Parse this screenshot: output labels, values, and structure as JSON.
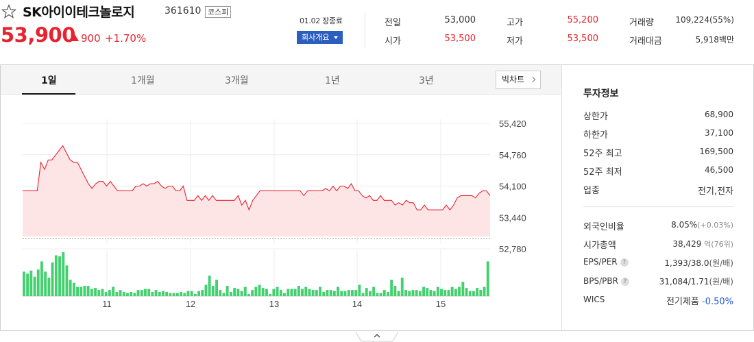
{
  "stock": {
    "name": "SK아이이테크놀로지",
    "code": "361610",
    "market": "코스피",
    "price": "53,900",
    "change": "900",
    "change_rate": "+1.70%",
    "date_status": "01.02 장종료",
    "overview_label": "회사개요"
  },
  "quotes": [
    {
      "label": "전일",
      "value": "53,000",
      "color": "#333333"
    },
    {
      "label": "고가",
      "value": "55,200",
      "color": "#e8232e"
    },
    {
      "label": "거래량",
      "value": "109,224(55%)",
      "color": "#333333"
    },
    {
      "label": "시가",
      "value": "53,500",
      "color": "#e8232e"
    },
    {
      "label": "저가",
      "value": "53,500",
      "color": "#e8232e"
    },
    {
      "label": "거래대금",
      "value": "5,918백만",
      "color": "#333333"
    }
  ],
  "tabs": [
    "1일",
    "1개월",
    "3개월",
    "1년",
    "3년"
  ],
  "active_tab": "1일",
  "big_chart_label": "빅차트",
  "info": {
    "title": "투자정보",
    "rows": [
      {
        "label": "상한가",
        "value": "68,900",
        "color": "#e8232e"
      },
      {
        "label": "하한가",
        "value": "37,100",
        "color": "#2657d9"
      },
      {
        "label": "52주 최고",
        "value": "169,500",
        "color": "#333333"
      },
      {
        "label": "52주 최저",
        "value": "46,500",
        "color": "#333333"
      },
      {
        "label": "업종",
        "value": "전기,전자",
        "color": "#333333"
      }
    ],
    "rows2": [
      {
        "label": "외국인비율",
        "value": "8.05%",
        "sub": "(+0.03%)"
      },
      {
        "label": "시가총액",
        "value": "38,429",
        "sub": "억(76위)"
      },
      {
        "label": "EPS/PER",
        "value": "1,393/38.0",
        "sub": "(원/배)",
        "help": "?"
      },
      {
        "label": "BPS/PBR",
        "value": "31,084/1.71",
        "sub": "(원/배)",
        "help": "?"
      },
      {
        "label": "WICS",
        "value": "전기제품",
        "sub": "-0.50%"
      }
    ]
  },
  "colors": {
    "accent_red": "#e8232e",
    "accent_blue": "#2657d9",
    "volume_green": "#43d06e",
    "button_blue": "#2c5fbd"
  },
  "chart_data": {
    "type": "area",
    "yticks": [
      "55,420",
      "54,760",
      "54,100",
      "53,440",
      "52,780"
    ],
    "ytick_values": [
      55420,
      54760,
      54100,
      53440,
      52780
    ],
    "xticks": [
      "11",
      "12",
      "13",
      "14",
      "15"
    ],
    "ylim": [
      52780,
      55420
    ],
    "prev_close": 53000,
    "grid": true,
    "price": [
      54000,
      54000,
      54000,
      54000,
      54000,
      54600,
      54450,
      54650,
      54650,
      54750,
      54850,
      54950,
      54800,
      54650,
      54600,
      54600,
      54450,
      54300,
      54150,
      54050,
      54150,
      54200,
      54200,
      54100,
      54200,
      54100,
      54000,
      54000,
      54000,
      54000,
      54000,
      54100,
      54100,
      54150,
      54100,
      54150,
      54150,
      54200,
      54100,
      54050,
      54100,
      54100,
      54000,
      54000,
      54100,
      53800,
      53800,
      53800,
      53900,
      53800,
      53900,
      53800,
      53900,
      53800,
      53800,
      53800,
      53800,
      53800,
      53800,
      53900,
      53700,
      53800,
      53600,
      53800,
      53900,
      54000,
      54000,
      54000,
      54000,
      54000,
      54000,
      54000,
      54000,
      54000,
      54000,
      54000,
      54000,
      53900,
      54000,
      54000,
      54000,
      54000,
      54000,
      54050,
      54000,
      54100,
      54000,
      54100,
      54100,
      54050,
      54150,
      54000,
      54000,
      53900,
      53850,
      53900,
      53800,
      53800,
      53900,
      53800,
      53800,
      53800,
      53700,
      53750,
      53700,
      53800,
      53750,
      53750,
      53600,
      53600,
      53700,
      53600,
      53600,
      53600,
      53600,
      53600,
      53700,
      53600,
      53700,
      53850,
      53900,
      53900,
      53900,
      53900,
      53850,
      53950,
      54000,
      54000,
      53900
    ],
    "volume": [
      24,
      22,
      25,
      19,
      26,
      34,
      24,
      18,
      33,
      40,
      39,
      43,
      30,
      16,
      13,
      9,
      9,
      10,
      10,
      7,
      8,
      6,
      7,
      4,
      6,
      9,
      4,
      6,
      4,
      3,
      4,
      3,
      6,
      6,
      7,
      7,
      4,
      6,
      4,
      5,
      4,
      3,
      3,
      3,
      4,
      3,
      5,
      5,
      2,
      5,
      6,
      11,
      20,
      10,
      16,
      6,
      3,
      10,
      4,
      8,
      7,
      5,
      9,
      2,
      6,
      9,
      11,
      8,
      7,
      2,
      7,
      9,
      6,
      3,
      7,
      7,
      7,
      10,
      7,
      9,
      7,
      6,
      6,
      9,
      4,
      6,
      6,
      5,
      9,
      5,
      5,
      6,
      6,
      6,
      11,
      3,
      8,
      5,
      9,
      3,
      3,
      6,
      4,
      16,
      10,
      5,
      18,
      6,
      5,
      6,
      6,
      5,
      9,
      8,
      6,
      5,
      9,
      7,
      6,
      6,
      9,
      7,
      9,
      14,
      8,
      5,
      5,
      8,
      6,
      9,
      34
    ]
  }
}
